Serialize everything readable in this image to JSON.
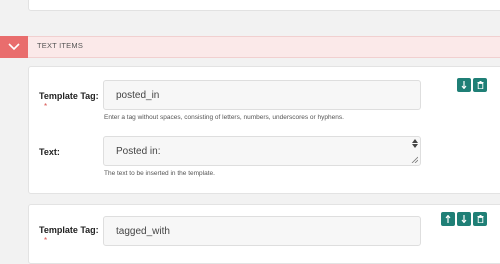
{
  "section": {
    "title": "TEXT ITEMS",
    "toggle_icon": "chevron-down-icon"
  },
  "items": [
    {
      "tag_label": "Template Tag:",
      "required_mark": "*",
      "tag_value": "posted_in",
      "tag_help": "Enter a tag without spaces, consisting of letters, numbers, underscores or hyphens.",
      "text_label": "Text:",
      "text_value": "Posted in:",
      "text_help": "The text to be inserted in the template.",
      "actions": [
        "move-down-icon",
        "trash-icon"
      ]
    },
    {
      "tag_label": "Template Tag:",
      "required_mark": "*",
      "tag_value": "tagged_with",
      "actions": [
        "move-up-icon",
        "move-down-icon",
        "trash-icon"
      ]
    }
  ],
  "colors": {
    "accent_red": "#e96d6d",
    "action_teal": "#1f7f76",
    "header_bg": "#fbe9e9"
  }
}
